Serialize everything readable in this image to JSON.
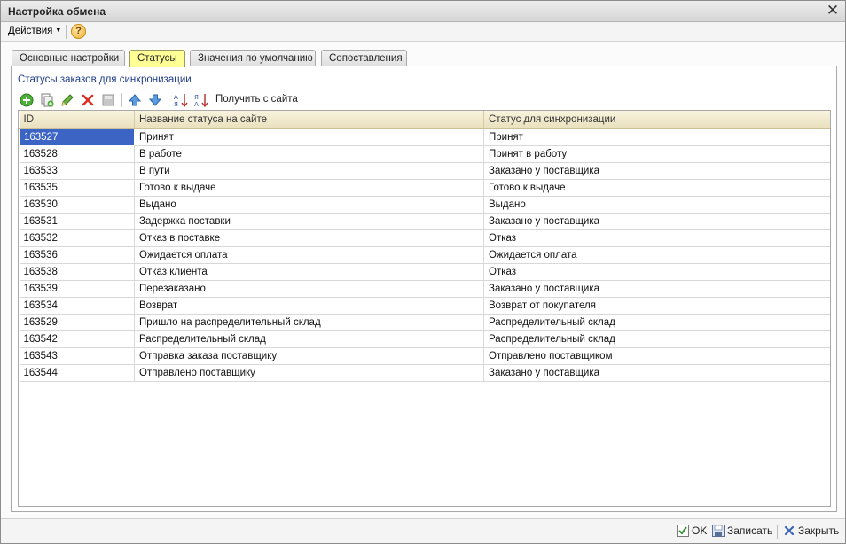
{
  "window": {
    "title": "Настройка обмена"
  },
  "menubar": {
    "actions_label": "Действия"
  },
  "tabs": [
    {
      "label": "Основные настройки"
    },
    {
      "label": "Статусы"
    },
    {
      "label": "Значения по умолчанию"
    },
    {
      "label": "Сопоставления"
    }
  ],
  "active_tab": "Статусы",
  "section": {
    "title": "Статусы заказов для синхронизации"
  },
  "toolbar": {
    "fetch_label": "Получить с сайта"
  },
  "grid": {
    "columns": [
      "ID",
      "Название статуса на сайте",
      "Статус для синхронизации"
    ],
    "rows": [
      {
        "id": "163527",
        "name": "Принят",
        "status": "Принят"
      },
      {
        "id": "163528",
        "name": "В работе",
        "status": "Принят в работу"
      },
      {
        "id": "163533",
        "name": "В пути",
        "status": "Заказано у поставщика"
      },
      {
        "id": "163535",
        "name": "Готово к выдаче",
        "status": "Готово к выдаче"
      },
      {
        "id": "163530",
        "name": "Выдано",
        "status": "Выдано"
      },
      {
        "id": "163531",
        "name": "Задержка поставки",
        "status": "Заказано у поставщика"
      },
      {
        "id": "163532",
        "name": "Отказ в поставке",
        "status": "Отказ"
      },
      {
        "id": "163536",
        "name": "Ожидается оплата",
        "status": "Ожидается оплата"
      },
      {
        "id": "163538",
        "name": "Отказ клиента",
        "status": "Отказ"
      },
      {
        "id": "163539",
        "name": "Перезаказано",
        "status": "Заказано у поставщика"
      },
      {
        "id": "163534",
        "name": "Возврат",
        "status": "Возврат от покупателя"
      },
      {
        "id": "163529",
        "name": "Пришло на распределительный склад",
        "status": "Распределительный склад"
      },
      {
        "id": "163542",
        "name": "Распределительный склад",
        "status": "Распределительный склад"
      },
      {
        "id": "163543",
        "name": "Отправка заказа поставщику",
        "status": "Отправлено поставщиком"
      },
      {
        "id": "163544",
        "name": "Отправлено поставщику",
        "status": "Заказано у поставщика"
      }
    ]
  },
  "bottom": {
    "ok_label": "OK",
    "save_label": "Записать",
    "close_label": "Закрыть"
  },
  "colors": {
    "active_tab": "#ffff96",
    "selection": "#3c64c4",
    "header": "#efe7c6"
  }
}
